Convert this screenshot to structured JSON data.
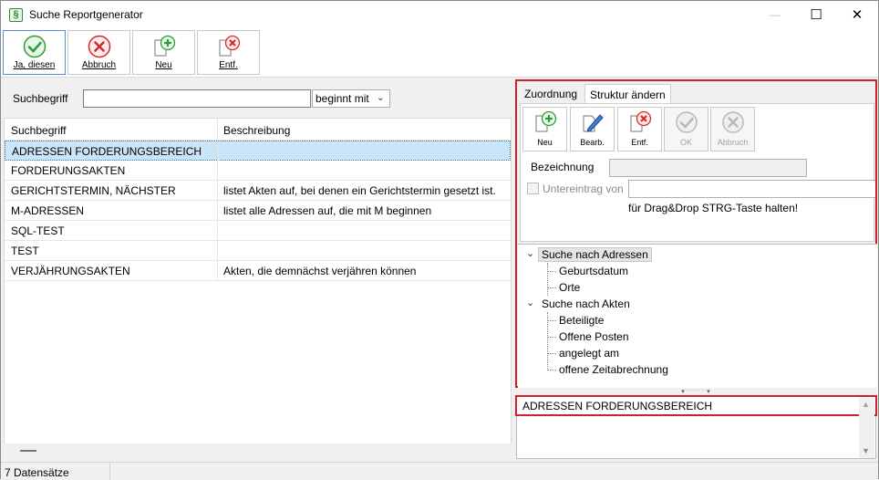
{
  "window": {
    "title": "Suche Reportgenerator",
    "app_icon_glyph": "§",
    "minimize_glyph": "—",
    "maximize_glyph": "☐",
    "close_glyph": "✕"
  },
  "toolbar": {
    "yes_label": "Ja, diesen",
    "cancel_label": "Abbruch",
    "new_label": "Neu",
    "delete_label": "Entf."
  },
  "search": {
    "label": "Suchbegriff",
    "value": "",
    "mode": "beginnt mit",
    "mode_chevron": "⌄"
  },
  "grid": {
    "columns": [
      "Suchbegriff",
      "Beschreibung"
    ],
    "rows": [
      {
        "term": "ADRESSEN FORDERUNGSBEREICH",
        "desc": ""
      },
      {
        "term": "FORDERUNGSAKTEN",
        "desc": ""
      },
      {
        "term": "GERICHTSTERMIN, NÄCHSTER",
        "desc": "listet Akten auf, bei denen ein Gerichtstermin gesetzt ist."
      },
      {
        "term": "M-ADRESSEN",
        "desc": "listet alle Adressen auf, die mit M beginnen"
      },
      {
        "term": "SQL-TEST",
        "desc": ""
      },
      {
        "term": "TEST",
        "desc": ""
      },
      {
        "term": "VERJÄHRUNGSAKTEN",
        "desc": "Akten, die demnächst verjähren können"
      }
    ]
  },
  "status": {
    "count_text": "7 Datensätze"
  },
  "right_panel": {
    "tabs": [
      "Zuordnung",
      "Struktur ändern"
    ],
    "buttons": {
      "new": "Neu",
      "edit": "Bearb.",
      "delete": "Entf.",
      "ok": "OK",
      "cancel": "Abbruch"
    },
    "bezeichnung_label": "Bezeichnung",
    "untereintrag_label": "Untereintrag von",
    "hint": "für Drag&Drop STRG-Taste halten!",
    "tree": {
      "group1": {
        "label": "Suche nach Adressen",
        "children": [
          "Geburtsdatum",
          "Orte"
        ]
      },
      "group2": {
        "label": "Suche nach Akten",
        "children": [
          "Beteiligte",
          "Offene Posten",
          "angelegt am",
          "offene Zeitabrechnung"
        ]
      },
      "expand_glyph": "⌄"
    },
    "splitter_glyph": "▾ˑˑˑˑˑˑˑˑ▾",
    "selected_text": "ADRESSEN FORDERUNGSBEREICH",
    "scroll_up_glyph": "▲",
    "scroll_down_glyph": "▼"
  },
  "colors": {
    "accent_red": "#d21f2c",
    "selection_blue": "#cce4f7",
    "ok_green": "#2e9b3a",
    "cancel_red": "#d42a2a"
  }
}
